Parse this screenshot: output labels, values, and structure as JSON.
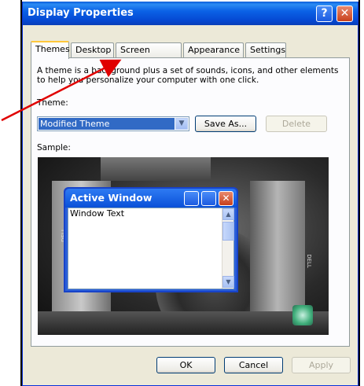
{
  "window": {
    "title": "Display Properties",
    "help_glyph": "?",
    "close_glyph": "✕"
  },
  "tabs": [
    {
      "label": "Themes",
      "active": true
    },
    {
      "label": "Desktop",
      "active": false
    },
    {
      "label": "Screen Saver",
      "active": false
    },
    {
      "label": "Appearance",
      "active": false
    },
    {
      "label": "Settings",
      "active": false
    }
  ],
  "themes_panel": {
    "description": "A theme is a background plus a set of sounds, icons, and other elements to help you personalize your computer with one click.",
    "theme_label": "Theme:",
    "theme_value": "Modified Theme",
    "save_as_label": "Save As...",
    "delete_label": "Delete",
    "sample_label": "Sample:"
  },
  "preview": {
    "active_window_title": "Active Window",
    "window_text": "Window Text",
    "dell_text_left": "DELL",
    "dell_text_right": "DELL"
  },
  "dialog_buttons": {
    "ok_label": "OK",
    "cancel_label": "Cancel",
    "apply_label": "Apply"
  },
  "colors": {
    "title_blue": "#0548d2",
    "annotation_red": "#e00000",
    "selection_blue": "#316ac5"
  }
}
